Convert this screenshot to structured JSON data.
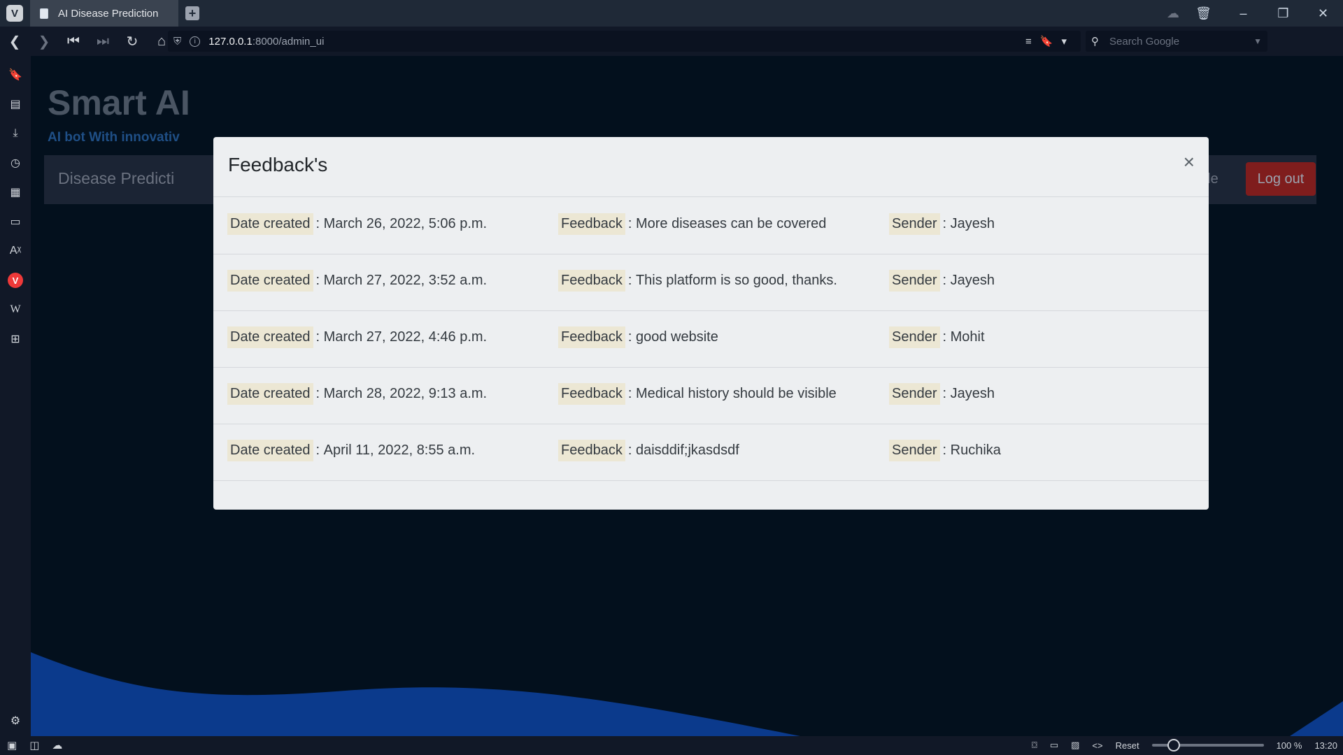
{
  "browser": {
    "tab_title": "AI Disease Prediction",
    "url_host": "127.0.0.1",
    "url_rest": ":8000/admin_ui",
    "search_placeholder": "Search Google",
    "zoom": "100 %",
    "reset_label": "Reset",
    "clock": "13:20"
  },
  "site": {
    "title": "Smart AI",
    "subtitle": "AI bot With innovativ",
    "nav_brand": "Disease Predicti",
    "profile_label": "Profile",
    "logout_label": "Log out"
  },
  "modal": {
    "title": "Feedback's",
    "close_glyph": "×",
    "labels": {
      "date": "Date created",
      "feedback": "Feedback",
      "sender": "Sender"
    },
    "rows": [
      {
        "date": "March 26, 2022, 5:06 p.m.",
        "feedback": "More diseases can be covered",
        "sender": "Jayesh"
      },
      {
        "date": "March 27, 2022, 3:52 a.m.",
        "feedback": "This platform is so good, thanks.",
        "sender": "Jayesh"
      },
      {
        "date": "March 27, 2022, 4:46 p.m.",
        "feedback": "good website",
        "sender": "Mohit"
      },
      {
        "date": "March 28, 2022, 9:13 a.m.",
        "feedback": "Medical history should be visible",
        "sender": "Jayesh"
      },
      {
        "date": "April 11, 2022, 8:55 a.m.",
        "feedback": "daisddif;jkasdsdf",
        "sender": "Ruchika"
      }
    ]
  },
  "colors": {
    "page_bg": "#03101d",
    "modal_bg": "#edeff1",
    "label_highlight": "#ece7d4",
    "logout_bg": "#7f1d1d",
    "wave": "#0b3a8c"
  }
}
